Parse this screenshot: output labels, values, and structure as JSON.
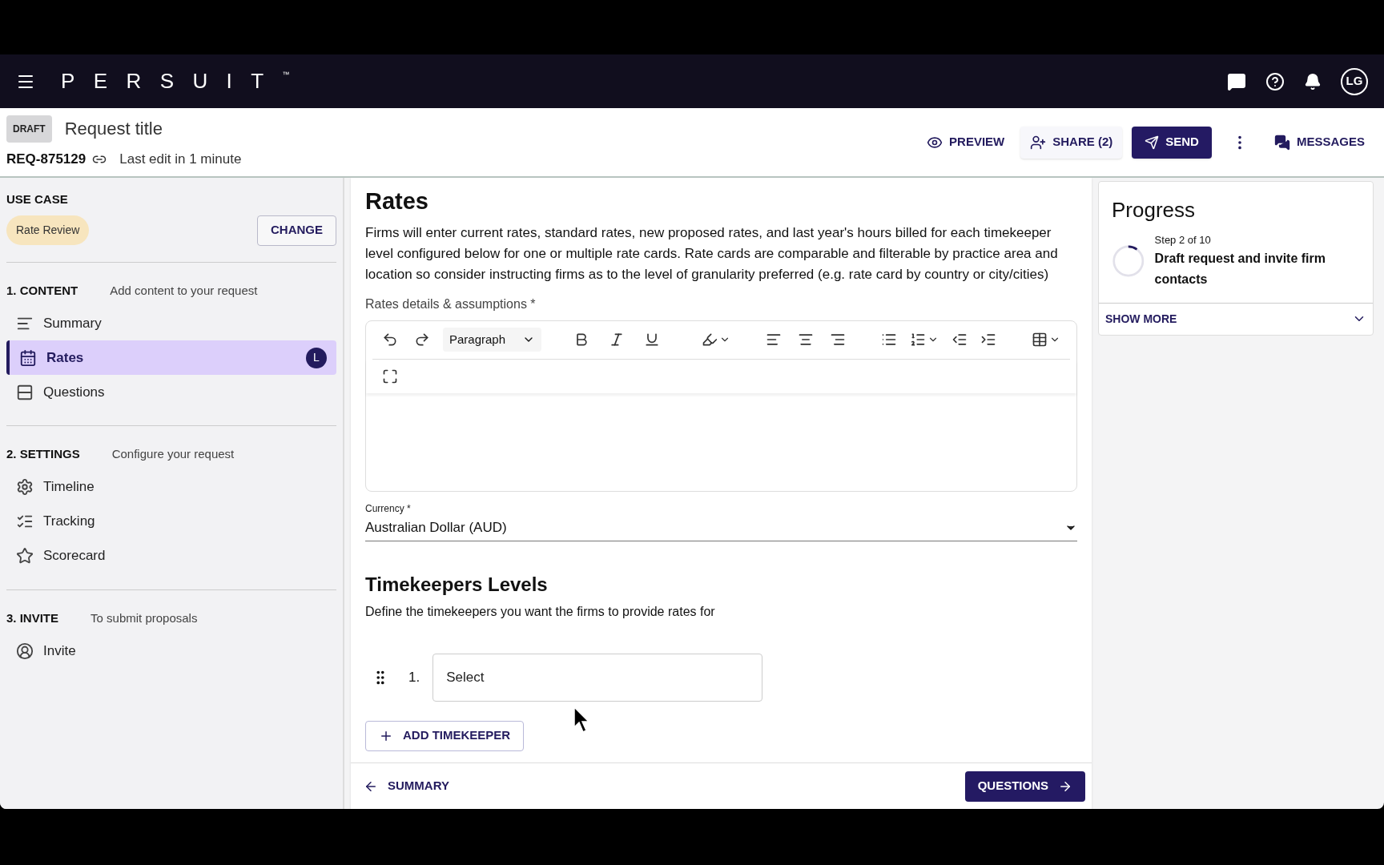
{
  "navbar": {
    "logo": "PERSUIT",
    "trademark": "™",
    "avatar": "LG"
  },
  "header": {
    "status": "DRAFT",
    "title": "Request title",
    "request_id": "REQ-875129",
    "last_edit": "Last edit in 1 minute",
    "actions": {
      "preview": "PREVIEW",
      "share": "SHARE (2)",
      "send": "SEND",
      "messages": "MESSAGES"
    }
  },
  "sidebar": {
    "use_case_label": "USE CASE",
    "use_case": "Rate Review",
    "change_button": "CHANGE",
    "sections": [
      {
        "title": "1. CONTENT",
        "subtitle": "Add content to your request",
        "items": [
          {
            "label": "Summary",
            "selected": false
          },
          {
            "label": "Rates",
            "selected": true,
            "badge": "L"
          },
          {
            "label": "Questions",
            "selected": false
          }
        ]
      },
      {
        "title": "2. SETTINGS",
        "subtitle": "Configure your request",
        "items": [
          {
            "label": "Timeline",
            "selected": false
          },
          {
            "label": "Tracking",
            "selected": false
          },
          {
            "label": "Scorecard",
            "selected": false
          }
        ]
      },
      {
        "title": "3. INVITE",
        "subtitle": "To submit proposals",
        "items": [
          {
            "label": "Invite",
            "selected": false
          }
        ]
      }
    ]
  },
  "main": {
    "title": "Rates",
    "description": "Firms will enter current rates, standard rates, new proposed rates, and last year's hours billed for each timekeeper level configured below for one or multiple rate cards. Rate cards are comparable and filterable by practice area and location so consider instructing firms as to the level of granularity preferred (e.g. rate card by country or city/cities)",
    "editor_label": "Rates details & assumptions *",
    "paragraph_style": "Paragraph",
    "currency_label": "Currency *",
    "currency_value": "Australian Dollar (AUD)",
    "timekeepers_title": "Timekeepers Levels",
    "timekeepers_description": "Define the timekeepers you want the firms to provide rates for",
    "timekeepers": [
      {
        "number": "1.",
        "placeholder": "Select"
      }
    ],
    "add_button": "ADD TIMEKEEPER",
    "back_button": "SUMMARY",
    "next_button": "QUESTIONS"
  },
  "progress": {
    "title": "Progress",
    "step": "Step 2 of 10",
    "level": 0.1,
    "stage": "Draft request and invite firm contacts",
    "show_more": "SHOW MORE"
  }
}
